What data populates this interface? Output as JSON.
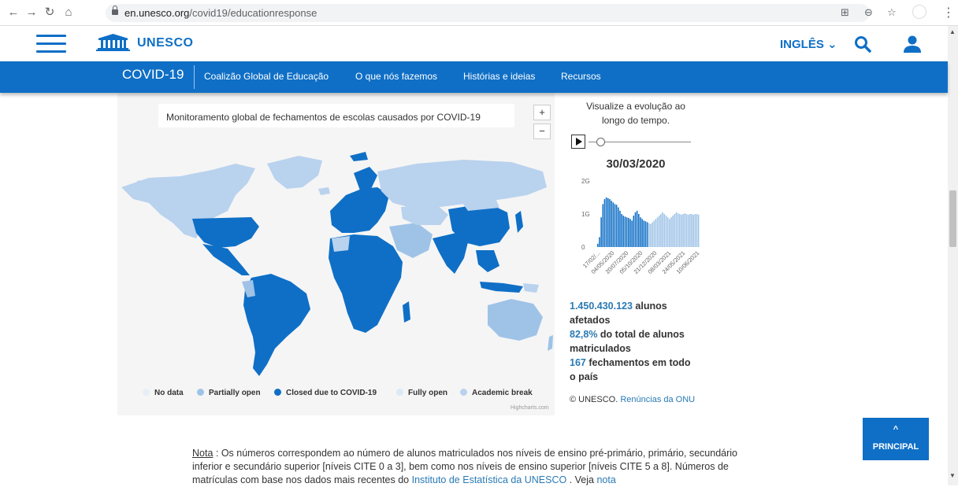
{
  "browser": {
    "url_host": "en.unesco.org",
    "url_path": "/covid19/educationresponse"
  },
  "header": {
    "logo_text": "UNESCO",
    "language": "INGLÊS",
    "language_chevron": "⌄"
  },
  "covid_nav": {
    "brand": "COVID-19",
    "items": [
      {
        "label": "Coalizão Global de Educação"
      },
      {
        "label": "O que nós fazemos"
      },
      {
        "label": "Histórias e ideias"
      },
      {
        "label": "Recursos"
      }
    ]
  },
  "map": {
    "title": "Monitoramento global de fechamentos de escolas causados por COVID-19",
    "zoom_in": "+",
    "zoom_out": "−",
    "credit": "Highcharts.com",
    "legend": [
      {
        "label": "No data",
        "color": "#e6eef7"
      },
      {
        "label": "Partially open",
        "color": "#9fc3e7"
      },
      {
        "label": "Closed due to COVID-19",
        "color": "#0f6fc6"
      },
      {
        "label": "Fully open",
        "color": "#dce8f5"
      },
      {
        "label": "Academic break",
        "color": "#b9d2ee"
      }
    ],
    "colors": {
      "closed": "#0f6fc6",
      "open": "#b9d2ee",
      "no_data": "#d6e4f3"
    }
  },
  "timeline": {
    "intro": "Visualize a evolução ao longo do tempo.",
    "date": "30/03/2020"
  },
  "chart_data": {
    "type": "bar",
    "title": "",
    "y_ticks": [
      "0",
      "1G",
      "2G"
    ],
    "ylim": [
      0,
      2
    ],
    "x_tick_labels": [
      "17/02/...",
      "04/05/2020",
      "20/07/2020",
      "05/10/2020",
      "21/12/2020",
      "08/03/2021",
      "24/05/2021",
      "10/06/2021"
    ],
    "series": [
      {
        "values": [
          0.1,
          0.3,
          0.9,
          1.3,
          1.45,
          1.5,
          1.48,
          1.45,
          1.4,
          1.35,
          1.3,
          1.28,
          1.2,
          1.1,
          1.0,
          0.95,
          0.92,
          0.9,
          0.88,
          0.85,
          0.8,
          0.95,
          1.05,
          1.1,
          1.0,
          0.9,
          0.85,
          0.8,
          0.78,
          0.75,
          0.72,
          0.7,
          0.75,
          0.8,
          0.85,
          0.9,
          0.95,
          1.0,
          1.05,
          1.0,
          0.95,
          0.9,
          0.85,
          0.9,
          0.95,
          1.0,
          1.05,
          1.02,
          1.0,
          0.98,
          1.0,
          1.02,
          1.0,
          0.98,
          1.0,
          1.0,
          0.98,
          1.0,
          1.0,
          0.98
        ]
      }
    ]
  },
  "stats": {
    "students_num": "1.450.430.123",
    "students_label_a": " alunos",
    "students_label_b": "afetados",
    "pct_num": "82,8%",
    "pct_label_a": " do total de alunos",
    "pct_label_b": "matriculados",
    "count_num": "167",
    "count_label_a": " fechamentos em todo",
    "count_label_b": "o país"
  },
  "copyright": {
    "text": "© UNESCO. ",
    "link": "Renúncias da ONU"
  },
  "back_to_top": {
    "chevron": "^",
    "label": "PRINCIPAL"
  },
  "note": {
    "label": "Nota",
    "text_1": " : Os números correspondem ao número de alunos matriculados nos níveis de ensino pré-primário, primário, secundário inferior e secundário superior [níveis CITE 0 a 3], bem como nos níveis de ensino superior [níveis CITE 5 a 8]. Números de matrículas com base nos dados mais recentes do ",
    "link_1": "Instituto de Estatística da UNESCO",
    "text_2": " . Veja ",
    "link_2": "nota"
  }
}
